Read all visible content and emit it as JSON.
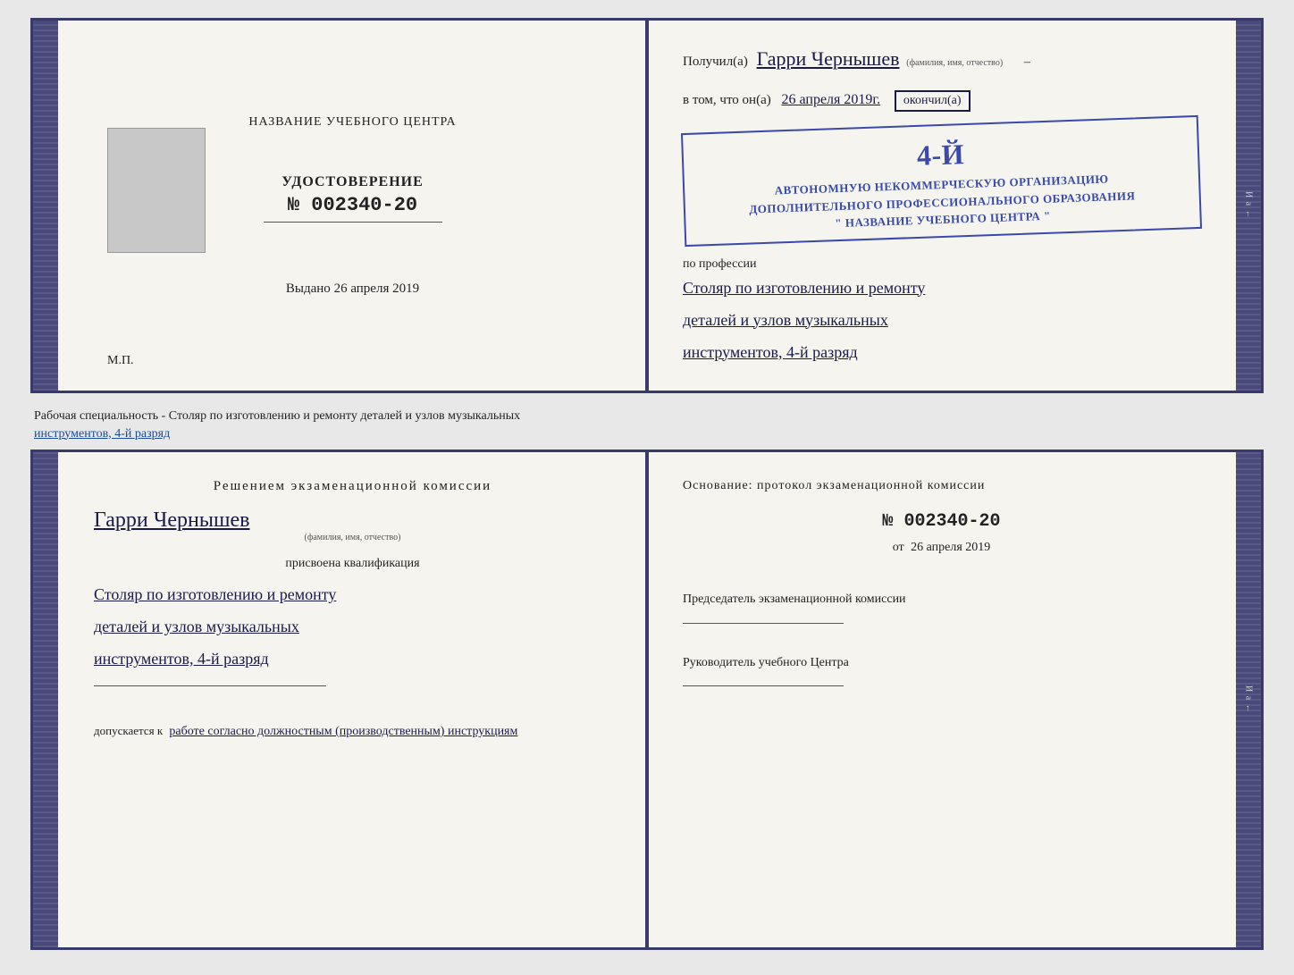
{
  "top_diploma": {
    "left": {
      "center_title": "НАЗВАНИЕ УЧЕБНОГО ЦЕНТРА",
      "udostoverenie_title": "УДОСТОВЕРЕНИЕ",
      "udostoverenie_num": "№ 002340-20",
      "vydano_label": "Выдано",
      "vydano_date": "26 апреля 2019",
      "mp": "М.П."
    },
    "right": {
      "poluchil_prefix": "Получил(а)",
      "name": "Гарри Чернышев",
      "fio_label": "(фамилия, имя, отчество)",
      "vtom_prefix": "в том, что он(а)",
      "vtom_date": "26 апреля 2019г.",
      "okonchil": "окончил(а)",
      "stamp_line1": "АВТОНОМНУЮ НЕКОММЕРЧЕСКУЮ ОРГАНИЗАЦИЮ",
      "stamp_line2": "ДОПОЛНИТЕЛЬНОГО ПРОФЕССИОНАЛЬНОГО ОБРАЗОВАНИЯ",
      "stamp_line3": "\" НАЗВАНИЕ УЧЕБНОГО ЦЕНТРА \"",
      "stamp_grade": "4-й",
      "po_professii": "по профессии",
      "profession_line1": "Столяр по изготовлению и ремонту",
      "profession_line2": "деталей и узлов музыкальных",
      "profession_line3": "инструментов, 4-й разряд"
    }
  },
  "separator": {
    "text": "Рабочая специальность - Столяр по изготовлению и ремонту деталей и узлов музыкальных",
    "text2": "инструментов, 4-й разряд"
  },
  "bottom_diploma": {
    "left": {
      "resheniem_title": "Решением  экзаменационной  комиссии",
      "name": "Гарри Чернышев",
      "fio_label": "(фамилия, имя, отчество)",
      "prisvoena": "присвоена квалификация",
      "profession_line1": "Столяр по изготовлению и ремонту",
      "profession_line2": "деталей и узлов музыкальных",
      "profession_line3": "инструментов, 4-й разряд",
      "dopuskaetsya": "допускается к",
      "dopusk_text": "работе согласно должностным (производственным) инструкциям"
    },
    "right": {
      "osnovanie": "Основание: протокол экзаменационной  комиссии",
      "protocol_num": "№  002340-20",
      "ot_prefix": "от",
      "ot_date": "26 апреля 2019",
      "predsedatel_title": "Председатель экзаменационной комиссии",
      "rukovoditel_title": "Руководитель учебного Центра"
    }
  }
}
